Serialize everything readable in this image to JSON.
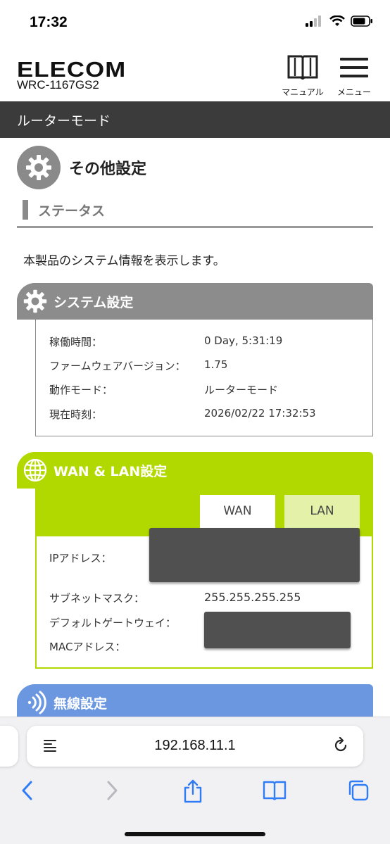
{
  "status_bar": {
    "time": "17:32"
  },
  "header": {
    "brand": "ELECOM",
    "model": "WRC-1167GS2",
    "manual_label": "マニュアル",
    "menu_label": "メニュー"
  },
  "mode_bar": {
    "text": "ルーターモード"
  },
  "page": {
    "title": "その他設定",
    "subtitle": "ステータス",
    "description": "本製品のシステム情報を表示します。"
  },
  "system": {
    "title": "システム設定",
    "rows": [
      {
        "label": "稼働時間：",
        "value": "0 Day, 5:31:19"
      },
      {
        "label": "ファームウェアバージョン：",
        "value": "1.75"
      },
      {
        "label": "動作モード：",
        "value": "ルーターモード"
      },
      {
        "label": "現在時刻：",
        "value": "2026/02/22 17:32:53"
      }
    ]
  },
  "wan_lan": {
    "title": "WAN & LAN設定",
    "tabs": [
      {
        "label": "WAN",
        "active": true
      },
      {
        "label": "LAN",
        "active": false
      }
    ],
    "rows": [
      {
        "label": "IPアドレス：",
        "value": ""
      },
      {
        "label": "サブネットマスク：",
        "value": "255.255.255.255"
      },
      {
        "label": "デフォルトゲートウェイ：",
        "value": ""
      },
      {
        "label": "MACアドレス：",
        "value": ""
      }
    ]
  },
  "wireless": {
    "title": "無線設定"
  },
  "browser": {
    "url": "192.168.11.1"
  },
  "colors": {
    "mode_bar": "#3b3b3b",
    "system_accent": "#8c8c8c",
    "wan_accent": "#b1d900",
    "lan_tab": "#e3f2a8",
    "wireless_accent": "#6b97e0",
    "safari_blue": "#2f7cf6"
  },
  "icons": {
    "manual": "book-icon",
    "menu": "hamburger-icon",
    "page": "gear-icon",
    "system": "gear-icon",
    "wan": "globe-icon",
    "wireless": "wifi-waves-icon"
  }
}
